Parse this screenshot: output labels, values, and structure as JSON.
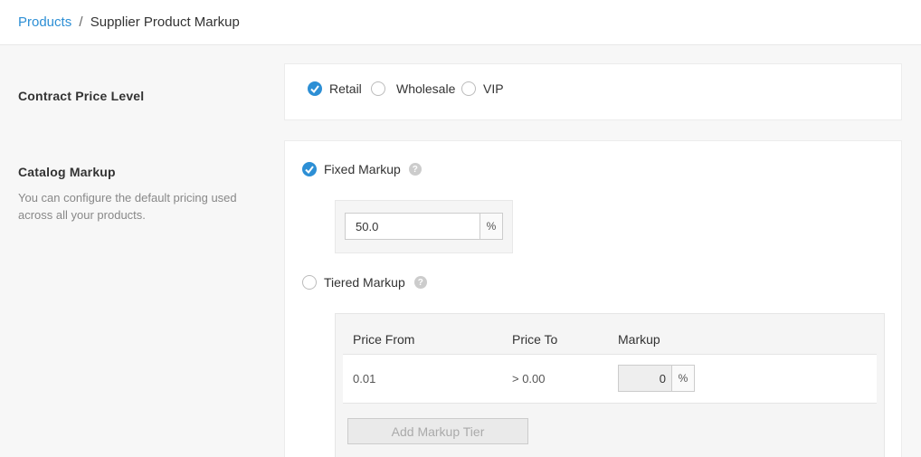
{
  "breadcrumb": {
    "link": "Products",
    "separator": "/",
    "current": "Supplier Product Markup"
  },
  "contract_price": {
    "title": "Contract Price Level",
    "options": [
      {
        "label": "Retail",
        "selected": true
      },
      {
        "label": "Wholesale",
        "selected": false
      },
      {
        "label": "VIP",
        "selected": false
      }
    ]
  },
  "catalog_markup": {
    "title": "Catalog Markup",
    "description": "You can configure the default pricing used across all your products.",
    "fixed": {
      "label": "Fixed Markup",
      "selected": true,
      "value": "50.0",
      "unit": "%"
    },
    "tiered": {
      "label": "Tiered Markup",
      "selected": false,
      "columns": [
        "Price From",
        "Price To",
        "Markup"
      ],
      "rows": [
        {
          "price_from": "0.01",
          "price_to": "> 0.00",
          "markup": "0",
          "unit": "%"
        }
      ],
      "add_button": "Add Markup Tier"
    }
  },
  "colors": {
    "accent": "#2d8fd5",
    "background": "#f7f7f7"
  },
  "icons": {
    "help": "?",
    "check": "check-icon"
  }
}
